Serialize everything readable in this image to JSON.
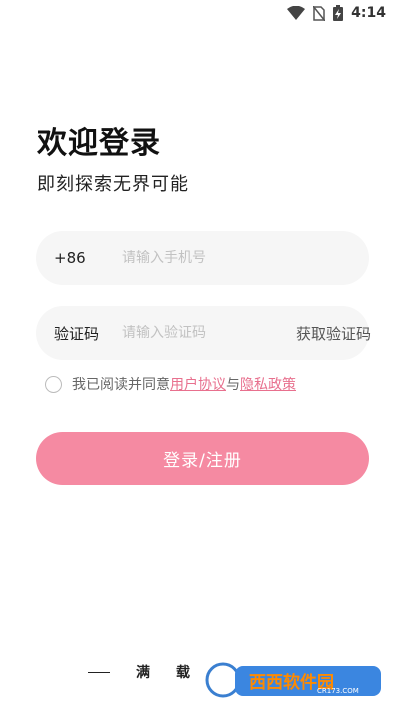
{
  "status_bar": {
    "time": "4:14"
  },
  "header": {
    "title": "欢迎登录",
    "subtitle": "即刻探索无界可能"
  },
  "phone_field": {
    "prefix": "+86",
    "value": "",
    "placeholder": "请输入手机号"
  },
  "code_field": {
    "label": "验证码",
    "value": "",
    "placeholder": "请输入验证码",
    "get_code_label": "获取验证码"
  },
  "agreement": {
    "prefix_text": "我已阅读并同意",
    "user_agreement": "用户协议",
    "joiner": "与",
    "privacy_policy": "隐私政策",
    "checked": false
  },
  "login_button": {
    "label": "登录/注册"
  },
  "footer": {
    "chars": [
      "满",
      "载"
    ]
  },
  "watermark": {
    "brand": "西西软件园",
    "domain": "CR173.COM"
  },
  "colors": {
    "accent": "#f58aa2",
    "link": "#e8708e",
    "field_bg": "#f6f6f6"
  }
}
